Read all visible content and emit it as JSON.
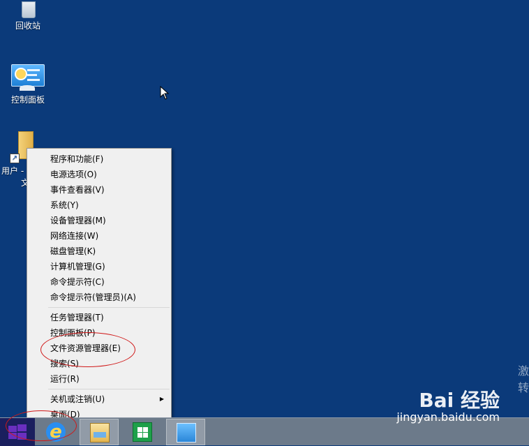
{
  "desktop": {
    "icons": [
      {
        "label": "回收站",
        "icon": "recycle-bin-icon"
      },
      {
        "label": "控制面板",
        "icon": "control-panel-icon"
      },
      {
        "label": "用户 -",
        "icon": "folder-shortcut-icon",
        "label_line2": "文"
      }
    ]
  },
  "context_menu": {
    "group1": [
      "程序和功能(F)",
      "电源选项(O)",
      "事件查看器(V)",
      "系统(Y)",
      "设备管理器(M)",
      "网络连接(W)",
      "磁盘管理(K)",
      "计算机管理(G)",
      "命令提示符(C)",
      "命令提示符(管理员)(A)"
    ],
    "group2": [
      "任务管理器(T)",
      "控制面板(P)",
      "文件资源管理器(E)",
      "搜索(S)",
      "运行(R)"
    ],
    "group3": [
      "关机或注销(U)",
      "桌面(D)"
    ],
    "submenu_arrow": "▶"
  },
  "taskbar": {
    "items": [
      "start-button",
      "internet-explorer",
      "file-explorer",
      "store",
      "control-panel"
    ]
  },
  "watermark": {
    "logo": "Bai 经验",
    "url": "jingyan.baidu.com"
  },
  "edge_text": [
    "激",
    "转"
  ],
  "colors": {
    "desktop": "#0b3a7a",
    "menu_bg": "#f0f0f0",
    "taskbar": "#6c7a8a",
    "annotation": "#d01818"
  }
}
